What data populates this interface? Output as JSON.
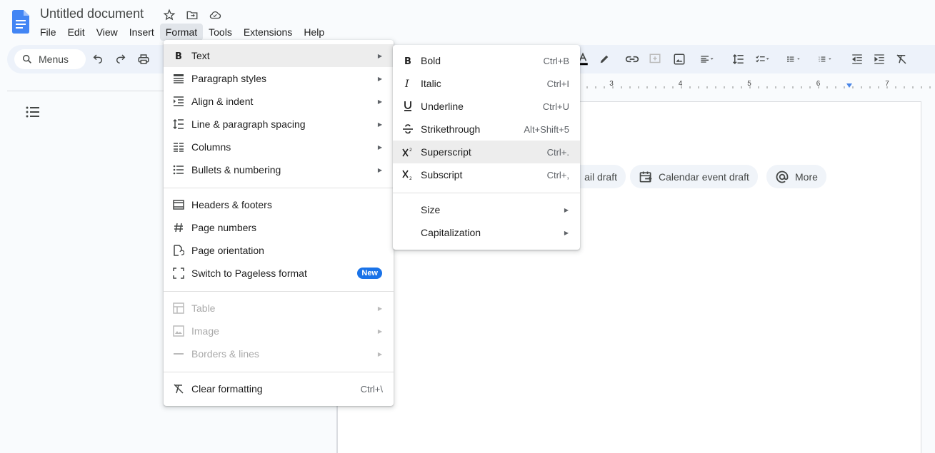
{
  "app": {
    "title": "Untitled document",
    "menubar": [
      "File",
      "Edit",
      "View",
      "Insert",
      "Format",
      "Tools",
      "Extensions",
      "Help"
    ],
    "active_menu": "Format"
  },
  "toolbar": {
    "search_label": "Menus"
  },
  "ruler": {
    "ticks": [
      "3",
      "4",
      "5",
      "6",
      "7"
    ]
  },
  "chips": [
    {
      "label": "ail draft",
      "icon": "email-icon"
    },
    {
      "label": "Calendar event draft",
      "icon": "calendar-icon"
    },
    {
      "label": "More",
      "icon": "at-icon"
    }
  ],
  "format_menu": {
    "items": [
      {
        "label": "Text",
        "icon": "bold-icon",
        "has_submenu": true
      },
      {
        "label": "Paragraph styles",
        "icon": "paragraph-styles-icon",
        "has_submenu": true
      },
      {
        "label": "Align & indent",
        "icon": "align-indent-icon",
        "has_submenu": true
      },
      {
        "label": "Line & paragraph spacing",
        "icon": "line-spacing-icon",
        "has_submenu": true
      },
      {
        "label": "Columns",
        "icon": "columns-icon",
        "has_submenu": true
      },
      {
        "label": "Bullets & numbering",
        "icon": "bullets-icon",
        "has_submenu": true
      },
      {
        "label": "Headers & footers",
        "icon": "headers-footers-icon"
      },
      {
        "label": "Page numbers",
        "icon": "hash-icon"
      },
      {
        "label": "Page orientation",
        "icon": "page-orientation-icon"
      },
      {
        "label": "Switch to Pageless format",
        "icon": "pageless-icon",
        "badge": "New"
      },
      {
        "label": "Table",
        "icon": "table-icon",
        "has_submenu": true,
        "disabled": true
      },
      {
        "label": "Image",
        "icon": "image-icon",
        "has_submenu": true,
        "disabled": true
      },
      {
        "label": "Borders & lines",
        "icon": "borders-icon",
        "has_submenu": true,
        "disabled": true
      },
      {
        "label": "Clear formatting",
        "icon": "clear-formatting-icon",
        "shortcut": "Ctrl+\\"
      }
    ]
  },
  "text_submenu": {
    "items": [
      {
        "label": "Bold",
        "icon": "bold-icon",
        "shortcut": "Ctrl+B"
      },
      {
        "label": "Italic",
        "icon": "italic-icon",
        "shortcut": "Ctrl+I"
      },
      {
        "label": "Underline",
        "icon": "underline-icon",
        "shortcut": "Ctrl+U"
      },
      {
        "label": "Strikethrough",
        "icon": "strikethrough-icon",
        "shortcut": "Alt+Shift+5"
      },
      {
        "label": "Superscript",
        "icon": "superscript-icon",
        "shortcut": "Ctrl+."
      },
      {
        "label": "Subscript",
        "icon": "subscript-icon",
        "shortcut": "Ctrl+,"
      },
      {
        "label": "Size",
        "has_submenu": true
      },
      {
        "label": "Capitalization",
        "has_submenu": true
      }
    ]
  },
  "colors": {
    "accent": "#1a73e8",
    "toolbar_bg": "#edf2fa",
    "highlight": "#ededed"
  }
}
